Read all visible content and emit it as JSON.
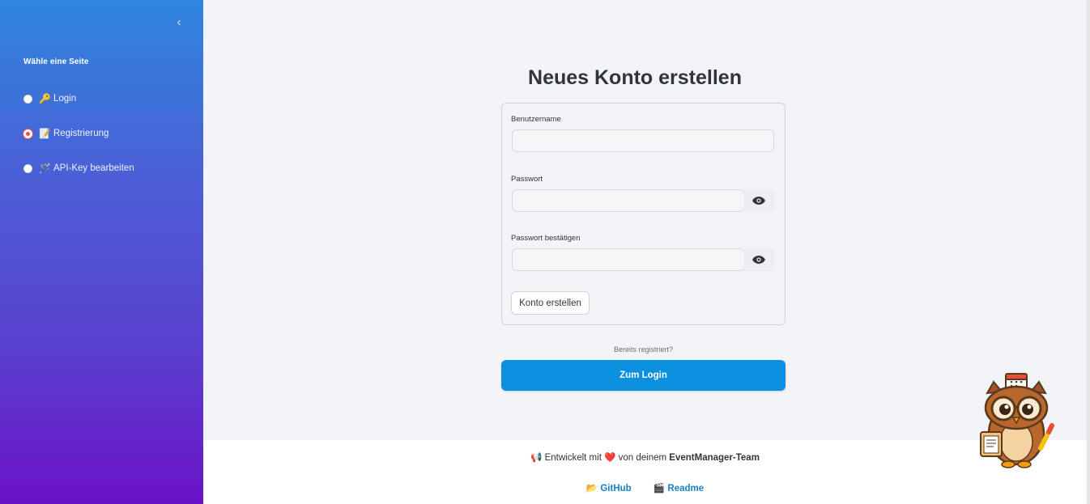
{
  "sidebar": {
    "collapse_icon": "chevron-left-icon",
    "heading": "Wähle eine Seite",
    "items": [
      {
        "emoji": "🔑",
        "icon": "key-icon",
        "label": "Login",
        "selected": false
      },
      {
        "emoji": "📝",
        "icon": "memo-icon",
        "label": "Registrierung",
        "selected": true
      },
      {
        "emoji": "🪄",
        "icon": "wand-icon",
        "label": "API-Key bearbeiten",
        "selected": false
      }
    ]
  },
  "main": {
    "title": "Neues Konto erstellen",
    "form": {
      "username_label": "Benutzername",
      "username_value": "",
      "password_label": "Passwort",
      "password_value": "",
      "confirm_label": "Passwort bestätigen",
      "confirm_value": "",
      "submit_label": "Konto erstellen"
    },
    "already_registered": "Bereits registriert?",
    "login_button": "Zum Login"
  },
  "footer": {
    "megaphone": "📢",
    "text_before": "Entwickelt mit",
    "heart": "❤️",
    "text_middle": "von deinem",
    "team": "EventManager-Team",
    "github_emoji": "📂",
    "github_label": "GitHub",
    "readme_emoji": "🎬",
    "readme_label": "Readme"
  },
  "colors": {
    "accent": "#0b90e0",
    "radio_selected": "#ff4b4b",
    "main_bg": "#f2f4f7"
  }
}
